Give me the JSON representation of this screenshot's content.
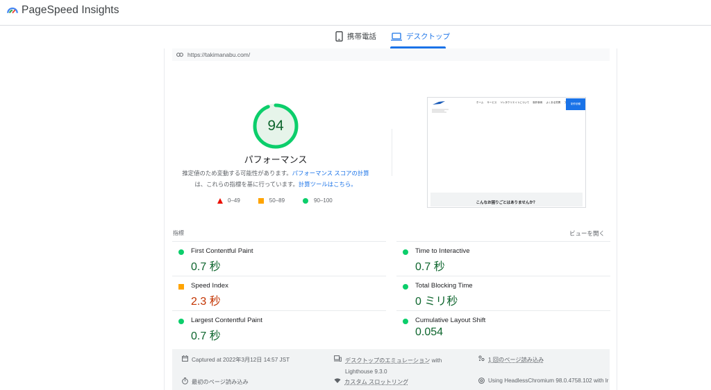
{
  "app": {
    "title": "PageSpeed Insights"
  },
  "tabs": [
    {
      "label": "携帯電話",
      "icon": "smartphone-icon"
    },
    {
      "label": "デスクトップ",
      "icon": "laptop-icon",
      "selected": true
    }
  ],
  "url": "https://takimanabu.com/",
  "performance": {
    "score": "94",
    "score_fraction": 0.94,
    "title": "パフォーマンス",
    "desc_part1": "推定値のため変動する可能性があります。",
    "desc_link1": "パフォーマンス スコアの計算",
    "desc_part2": "は、これらの指標を基に行っています。",
    "desc_link2": "計算ツールはこちら。",
    "legend": [
      {
        "range": "0–49",
        "color": "#eb0f00"
      },
      {
        "range": "50–89",
        "color": "#ffa400"
      },
      {
        "range": "90–100",
        "color": "#0cce6b"
      }
    ]
  },
  "screenshot": {
    "nav": [
      "ホーム",
      "サービス",
      "ソレタクリエイトについて",
      "制作事例",
      "よくある質問",
      "ブログ"
    ],
    "cta": "制作依頼",
    "bottom_text": "こんなお困りごとはありませんか？"
  },
  "metrics_section": {
    "label": "指標",
    "expand": "ビューを開く"
  },
  "metrics": [
    {
      "name": "First Contentful Paint",
      "value": "0.7 秒",
      "status": "good"
    },
    {
      "name": "Time to Interactive",
      "value": "0.7 秒",
      "status": "good"
    },
    {
      "name": "Speed Index",
      "value": "2.3 秒",
      "status": "average"
    },
    {
      "name": "Total Blocking Time",
      "value": "0 ミリ秒",
      "status": "good"
    },
    {
      "name": "Largest Contentful Paint",
      "value": "0.7 秒",
      "status": "good"
    },
    {
      "name": "Cumulative Layout Shift",
      "value": "0.054",
      "status": "good"
    }
  ],
  "footer": {
    "captured": "Captured at 2022年3月12日 14:57 JST",
    "emulation_link": "デスクトップのエミュレーション",
    "emulation_tail": " with",
    "emulation_line2": "Lighthouse 9.3.0",
    "page_load": "1 回のページ読み込み",
    "initial_load": "最初のページ読み込み",
    "throttling": "カスタム スロットリング",
    "browser": "Using HeadlessChromium 98.0.4758.102 with lr"
  },
  "colors": {
    "accent": "#1a73e8",
    "good": "#0cce6b",
    "average": "#ffa400",
    "poor": "#eb0f00"
  }
}
